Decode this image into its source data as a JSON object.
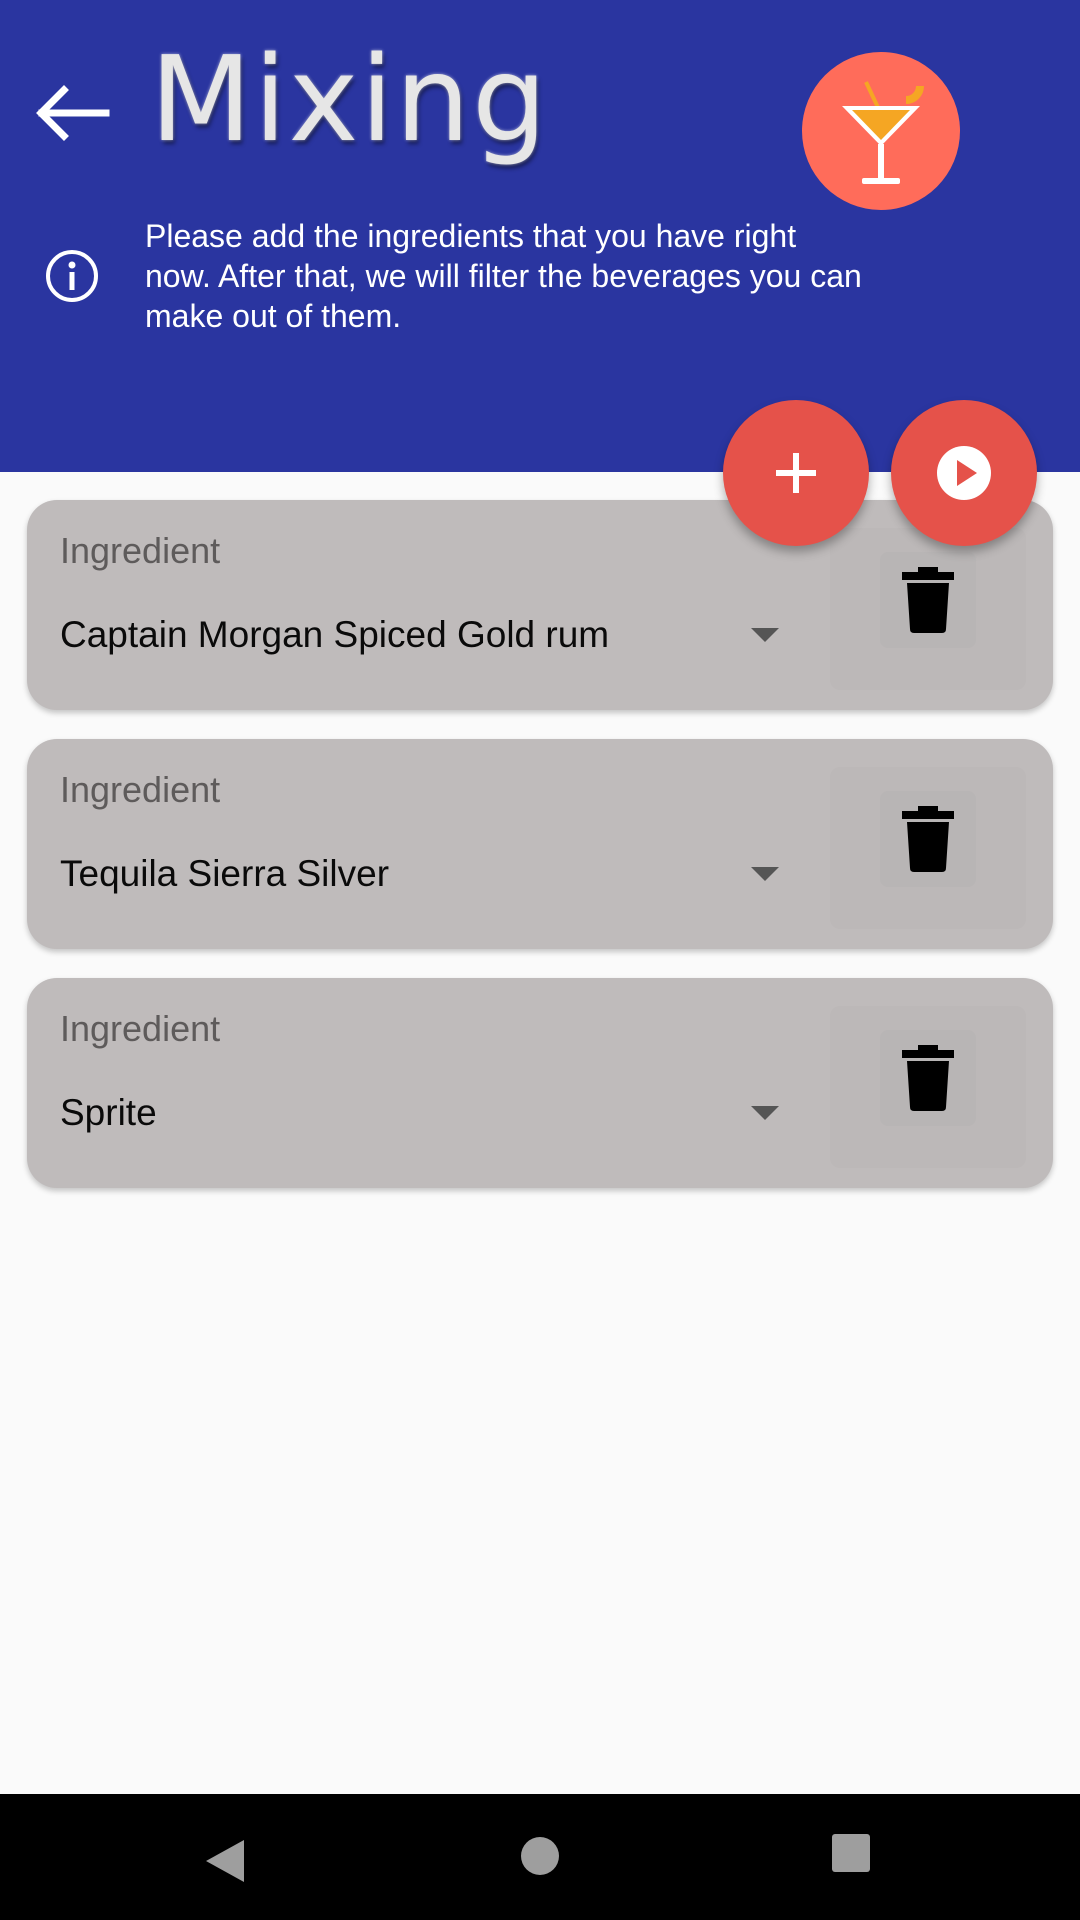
{
  "header": {
    "title": "Mixing",
    "info_text": "Please add the ingredients that you have right now. After that, we will filter the beverages you can make out of them.",
    "background_color": "#2a35a0"
  },
  "logo": {
    "icon": "cocktail-glass-icon",
    "color": "#ff6c5a"
  },
  "actions": {
    "add_icon": "plus-icon",
    "mix_icon": "play-circle-icon",
    "color": "#e5524a"
  },
  "ingredients": [
    {
      "label": "Ingredient",
      "value": "Captain Morgan Spiced Gold rum"
    },
    {
      "label": "Ingredient",
      "value": "Tequila Sierra Silver"
    },
    {
      "label": "Ingredient",
      "value": "Sprite"
    }
  ],
  "navbar": {
    "icons": [
      "back-triangle-icon",
      "home-circle-icon",
      "recents-square-icon"
    ]
  }
}
